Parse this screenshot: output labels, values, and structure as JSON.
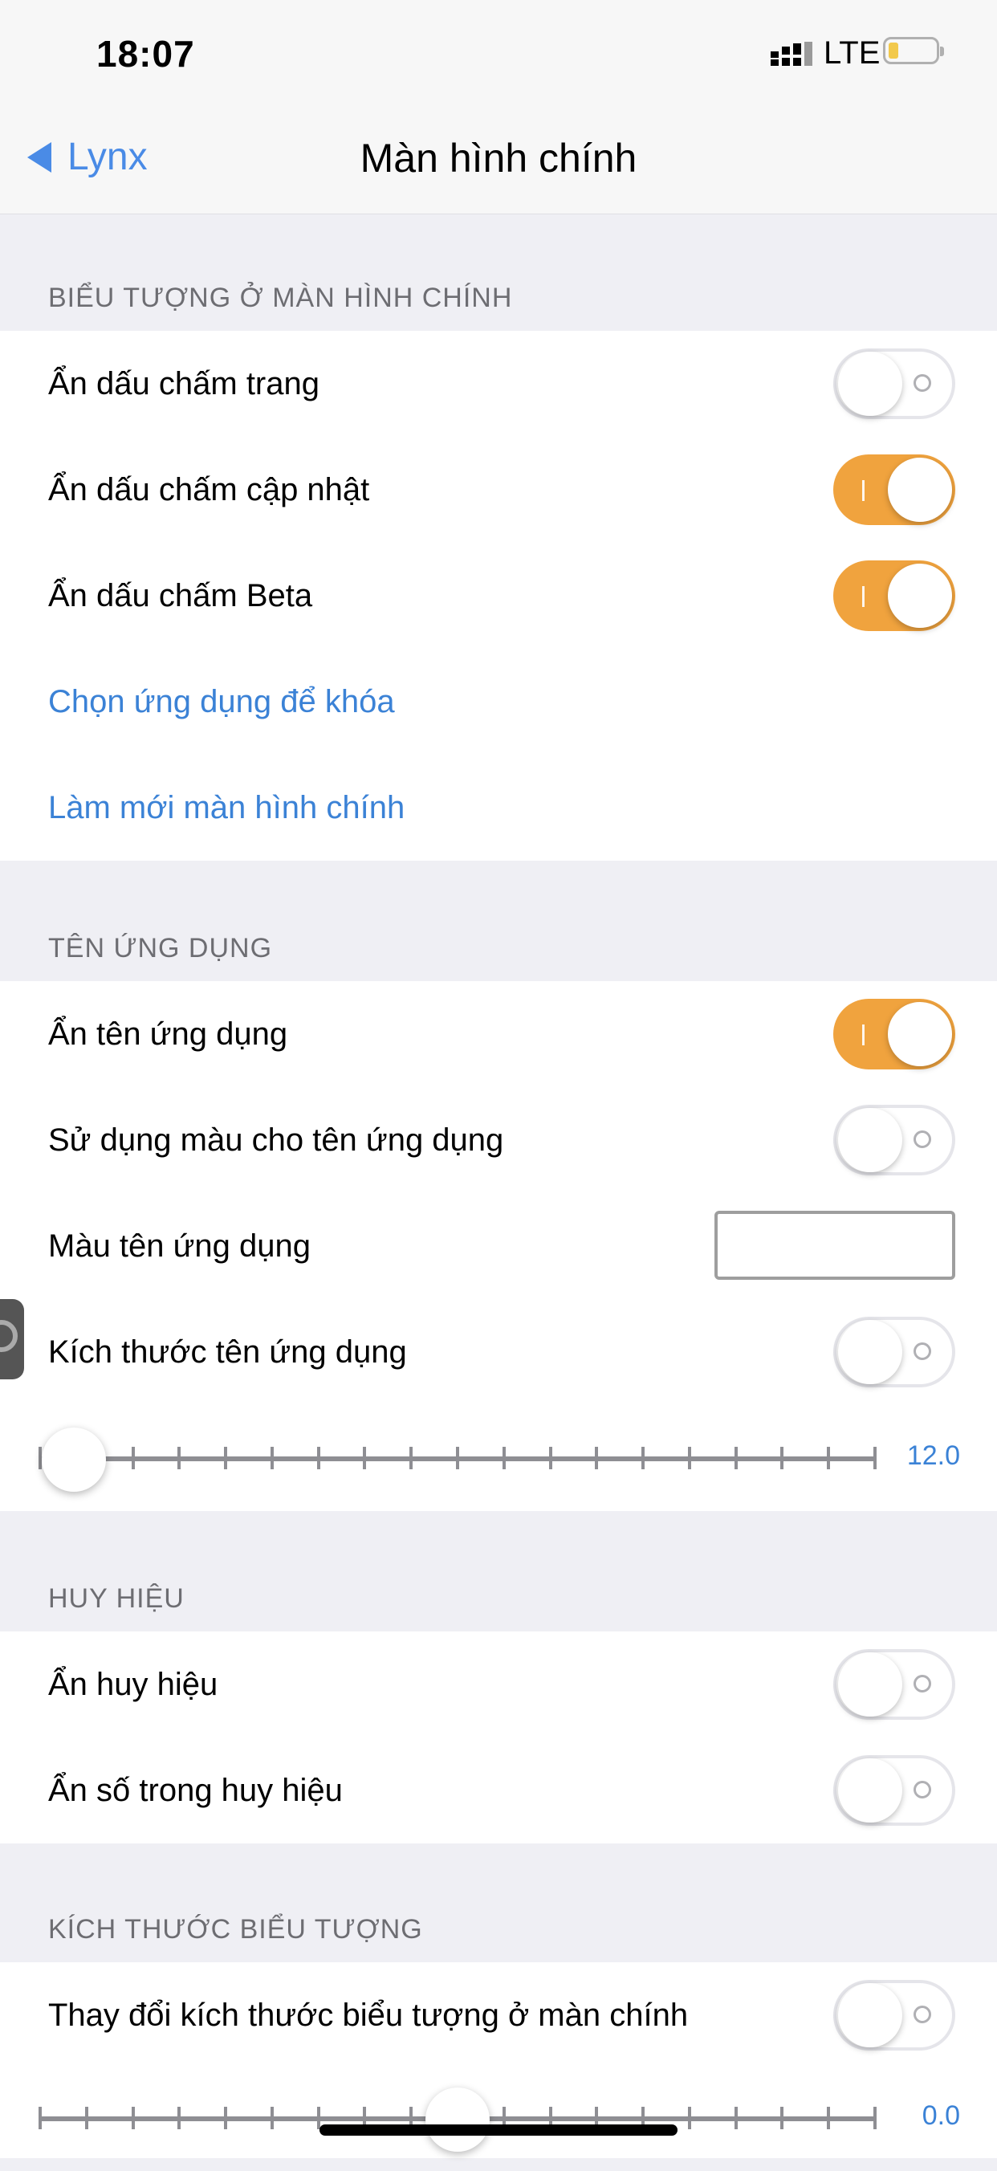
{
  "status_bar": {
    "time": "18:07",
    "network": "LTE",
    "battery_color": "#f2c94c"
  },
  "nav": {
    "back_label": "Lynx",
    "title": "Màn hình chính"
  },
  "accent_color": "#f0a33e",
  "link_color": "#3b82d6",
  "sections": {
    "icons": {
      "header": "BIỂU TƯỢNG Ở MÀN HÌNH CHÍNH",
      "hide_page_dots": {
        "label": "Ẩn dấu chấm trang",
        "on": false
      },
      "hide_update_dots": {
        "label": "Ẩn dấu chấm cập nhật",
        "on": true
      },
      "hide_beta_dots": {
        "label": "Ẩn dấu chấm Beta",
        "on": true
      },
      "choose_apps_link": "Chọn ứng dụng để khóa",
      "refresh_link": "Làm mới màn hình chính"
    },
    "app_name": {
      "header": "TÊN ỨNG DỤNG",
      "hide_app_name": {
        "label": "Ẩn tên ứng dụng",
        "on": true
      },
      "use_color": {
        "label": "Sử dụng màu cho tên ứng dụng",
        "on": false
      },
      "name_color": {
        "label": "Màu tên ứng dụng",
        "value": "#ffffff"
      },
      "name_size": {
        "label": "Kích thước tên ứng dụng",
        "on": false
      },
      "size_slider": {
        "value": "12.0",
        "fraction": 0.04
      }
    },
    "badges": {
      "header": "HUY HIỆU",
      "hide_badges": {
        "label": "Ẩn huy hiệu",
        "on": false
      },
      "hide_badge_numbers": {
        "label": "Ẩn số trong huy hiệu",
        "on": false
      }
    },
    "icon_size": {
      "header": "KÍCH THƯỚC BIỂU TƯỢNG",
      "resize_icons": {
        "label": "Thay đổi kích thước biểu tượng ở màn chính",
        "on": false
      },
      "size_slider": {
        "value": "0.0",
        "fraction": 0.5
      }
    }
  }
}
